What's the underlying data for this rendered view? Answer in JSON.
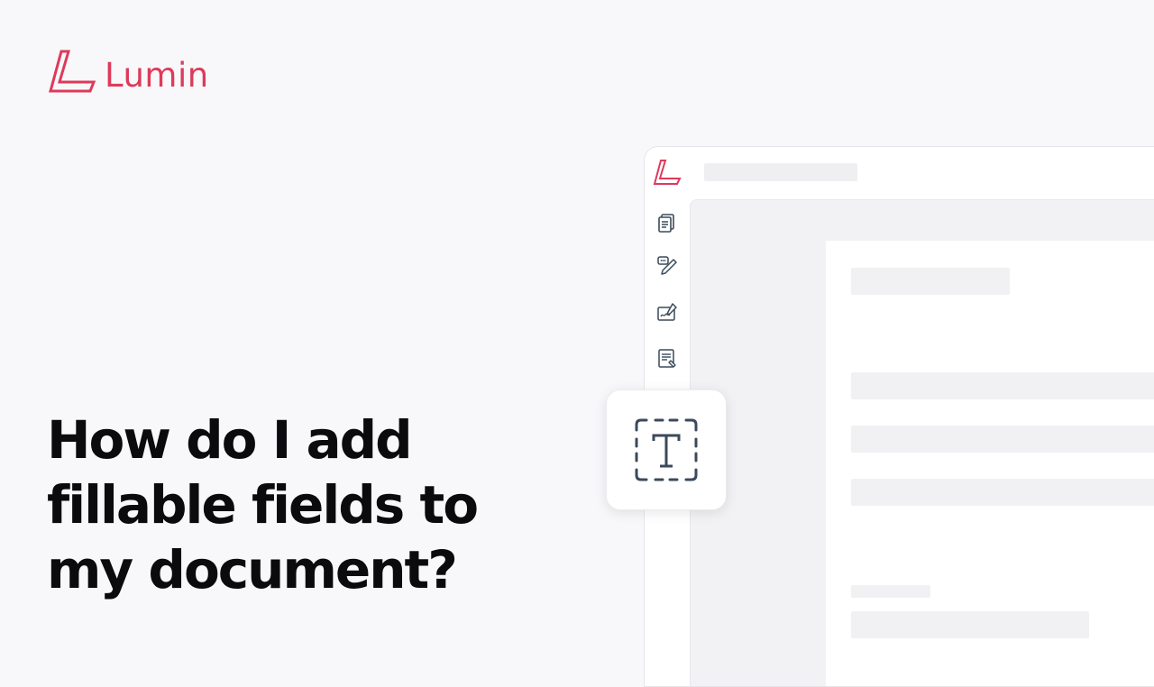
{
  "brand": {
    "name": "Lumin",
    "accent_color": "#de3a5a",
    "logo_icon": "lumin-l-icon"
  },
  "headline": {
    "lines": [
      "How do I add",
      "fillable fields to",
      "my document?"
    ]
  },
  "app": {
    "sidebar_icons": [
      "documents-icon",
      "comment-pen-icon",
      "signature-icon",
      "form-edit-icon"
    ],
    "featured_tool_icon": "text-field-icon",
    "icon_color": "#3b4a5a"
  }
}
